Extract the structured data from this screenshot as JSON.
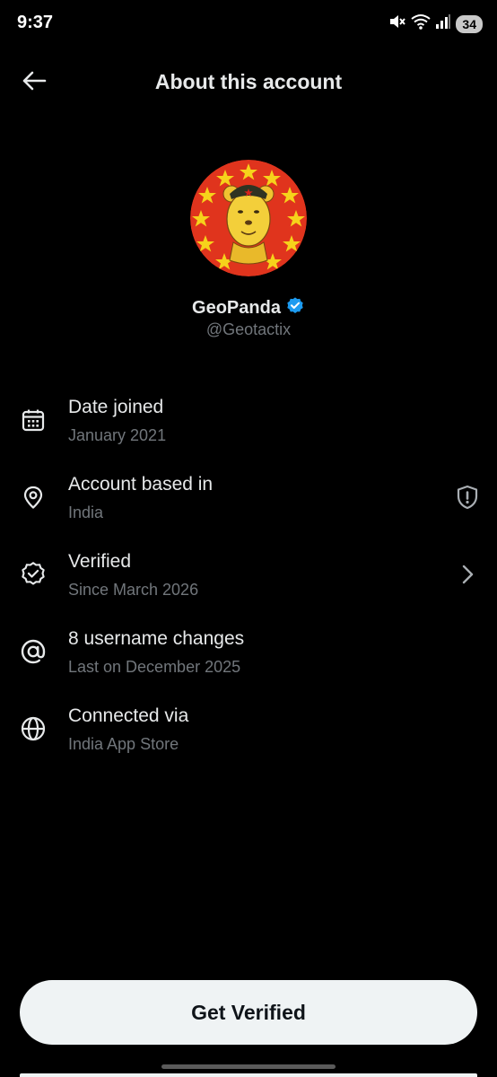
{
  "status_bar": {
    "time": "9:37",
    "battery": "34",
    "icons": [
      "mute-icon",
      "wifi-icon",
      "signal-icon",
      "battery-icon"
    ]
  },
  "header": {
    "title": "About this account",
    "back_icon": "arrow-left-icon"
  },
  "profile": {
    "display_name": "GeoPanda",
    "handle": "@Geotactix",
    "verified_badge_color": "#1d9bf0",
    "avatar_bg_color": "#e0341d",
    "avatar_star_color": "#f6d21b"
  },
  "info_rows": [
    {
      "icon": "calendar-icon",
      "title": "Date joined",
      "subtitle": "January 2021",
      "trailing": ""
    },
    {
      "icon": "location-pin-icon",
      "title": "Account based in",
      "subtitle": "India",
      "trailing": "shield-alert-icon"
    },
    {
      "icon": "verified-badge-icon",
      "title": "Verified",
      "subtitle": "Since March 2026",
      "trailing": "chevron-right-icon"
    },
    {
      "icon": "at-sign-icon",
      "title": "8 username changes",
      "subtitle": "Last on December 2025",
      "trailing": ""
    },
    {
      "icon": "globe-icon",
      "title": "Connected via",
      "subtitle": "India App Store",
      "trailing": ""
    }
  ],
  "cta": {
    "label": "Get Verified"
  },
  "colors": {
    "background": "#000000",
    "primary_text": "#e7e9ea",
    "secondary_text": "#71767b",
    "button_bg": "#eff3f4"
  }
}
